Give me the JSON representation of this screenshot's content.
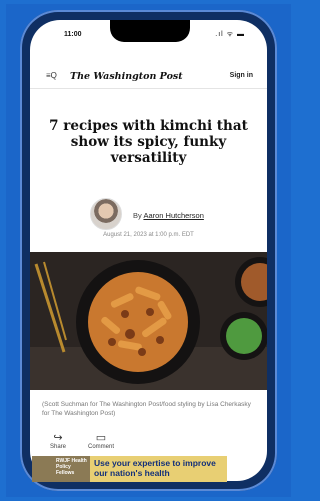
{
  "status_bar": {
    "time": "11:00",
    "icons": ".ıl ᯤ ▬"
  },
  "header": {
    "menu_icon": "≡Q",
    "masthead": "The Washington Post",
    "sign_in": "Sign in"
  },
  "article": {
    "headline": "7 recipes with kimchi that show its spicy, funky versatility",
    "byline_prefix": "By",
    "author": "Aaron Hutcherson",
    "dateline": "August 21, 2023 at 1:00 p.m. EDT",
    "caption": "(Scott Suchman for The Washington Post/food styling by Lisa Cherkasky for The Washington Post)"
  },
  "actions": {
    "share": "Share",
    "comment": "Comment"
  },
  "ad": {
    "left_text": "RWJF Health Policy Fellows",
    "headline": "Use your expertise to improve our nation's health"
  }
}
